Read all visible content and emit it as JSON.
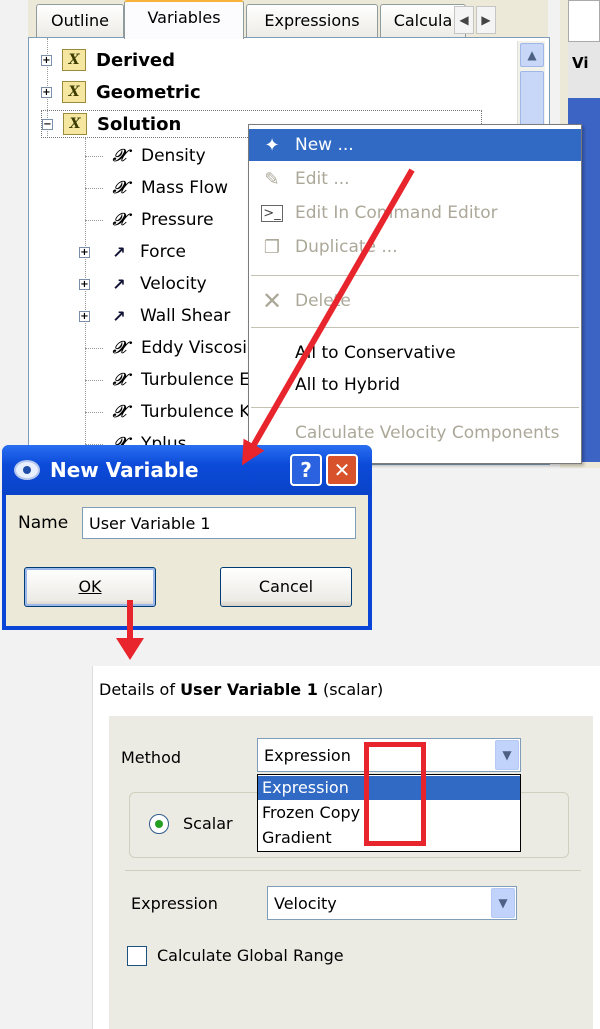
{
  "tabs": [
    "Outline",
    "Variables",
    "Expressions",
    "Calcula"
  ],
  "active_tab": "Variables",
  "right_panel_header": "Vi",
  "tree": {
    "groups": [
      {
        "label": "Derived",
        "expanded": false
      },
      {
        "label": "Geometric",
        "expanded": false
      },
      {
        "label": "Solution",
        "expanded": true
      }
    ],
    "children": [
      {
        "label": "Density",
        "kind": "scalar"
      },
      {
        "label": "Mass Flow",
        "kind": "scalar"
      },
      {
        "label": "Pressure",
        "kind": "scalar"
      },
      {
        "label": "Force",
        "kind": "vector"
      },
      {
        "label": "Velocity",
        "kind": "vector"
      },
      {
        "label": "Wall Shear",
        "kind": "vector"
      },
      {
        "label": "Eddy Viscosi",
        "kind": "scalar"
      },
      {
        "label": "Turbulence E",
        "kind": "scalar"
      },
      {
        "label": "Turbulence K",
        "kind": "scalar"
      },
      {
        "label": "Yplus",
        "kind": "scalar"
      }
    ]
  },
  "context_menu": {
    "items": [
      {
        "label": "New ...",
        "state": "highlighted",
        "icon": "new-icon"
      },
      {
        "label": "Edit ...",
        "state": "disabled",
        "icon": "edit-icon"
      },
      {
        "label": "Edit In Command Editor",
        "state": "disabled",
        "icon": "command-editor-icon"
      },
      {
        "label": "Duplicate ...",
        "state": "disabled",
        "icon": "duplicate-icon"
      },
      {
        "label": "Delete",
        "state": "disabled",
        "icon": "delete-icon"
      },
      {
        "label": "All to Conservative",
        "state": "enabled"
      },
      {
        "label": "All to Hybrid",
        "state": "enabled"
      },
      {
        "label": "Calculate Velocity Components",
        "state": "disabled"
      }
    ]
  },
  "dialog": {
    "title": "New Variable",
    "help_label": "?",
    "close_label": "✕",
    "name_label": "Name",
    "name_value": "User Variable 1",
    "ok_label": "OK",
    "cancel_label": "Cancel"
  },
  "details": {
    "title_prefix": "Details of ",
    "title_name": "User Variable 1",
    "title_suffix": " (scalar)",
    "method_label": "Method",
    "method_value": "Expression",
    "method_options": [
      "Expression",
      "Frozen Copy",
      "Gradient"
    ],
    "scalar_label": "Scalar",
    "expression_label": "Expression",
    "expression_value": "Velocity",
    "global_range_label": "Calculate Global Range"
  },
  "colors": {
    "annotation_red": "#e8242c",
    "selection_blue": "#316ac5",
    "xp_title_blue": "#0a45d8"
  }
}
